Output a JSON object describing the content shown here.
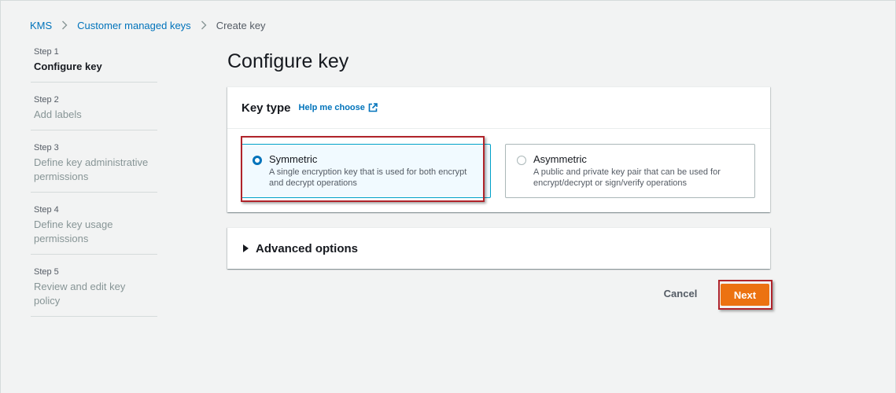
{
  "breadcrumb": {
    "items": [
      "KMS",
      "Customer managed keys"
    ],
    "current": "Create key"
  },
  "steps": [
    {
      "num": "Step 1",
      "title": "Configure key"
    },
    {
      "num": "Step 2",
      "title": "Add labels"
    },
    {
      "num": "Step 3",
      "title": "Define key administrative permissions"
    },
    {
      "num": "Step 4",
      "title": "Define key usage permissions"
    },
    {
      "num": "Step 5",
      "title": "Review and edit key policy"
    }
  ],
  "page_title": "Configure key",
  "key_type": {
    "title": "Key type",
    "help_link": "Help me choose",
    "options": [
      {
        "label": "Symmetric",
        "description": "A single encryption key that is used for both encrypt and decrypt operations",
        "selected": true
      },
      {
        "label": "Asymmetric",
        "description": "A public and private key pair that can be used for encrypt/decrypt or sign/verify operations",
        "selected": false
      }
    ]
  },
  "advanced": {
    "title": "Advanced options"
  },
  "actions": {
    "cancel": "Cancel",
    "next": "Next"
  },
  "colors": {
    "primary_button": "#ec7211",
    "link": "#0073bb",
    "highlight": "#b0232a",
    "selected_tile_border": "#00a1c9"
  }
}
